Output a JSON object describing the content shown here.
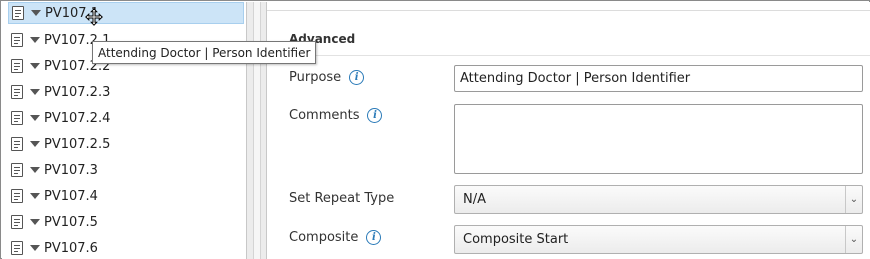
{
  "tree": {
    "items": [
      {
        "label": "PV107.1"
      },
      {
        "label": "PV107.2.1"
      },
      {
        "label": "PV107.2.2"
      },
      {
        "label": "PV107.2.3"
      },
      {
        "label": "PV107.2.4"
      },
      {
        "label": "PV107.2.5"
      },
      {
        "label": "PV107.3"
      },
      {
        "label": "PV107.4"
      },
      {
        "label": "PV107.5"
      },
      {
        "label": "PV107.6"
      }
    ],
    "selected_index": 0
  },
  "tooltip": {
    "text": "Attending Doctor | Person Identifier"
  },
  "form": {
    "section_title": "Advanced",
    "purpose": {
      "label": "Purpose",
      "value": "Attending Doctor | Person Identifier"
    },
    "comments": {
      "label": "Comments",
      "value": ""
    },
    "set_repeat_type": {
      "label": "Set Repeat Type",
      "value": "N/A"
    },
    "composite": {
      "label": "Composite",
      "value": "Composite Start"
    }
  },
  "colors": {
    "selection": "#cce4f7",
    "info_icon": "#2a7ab8",
    "border": "#8a8a8a"
  },
  "icons": {
    "tree_item": "document-icon",
    "expander": "triangle-down-icon",
    "info": "info-icon",
    "select_arrow": "chevron-down-icon",
    "cursor": "move-cursor-icon"
  }
}
